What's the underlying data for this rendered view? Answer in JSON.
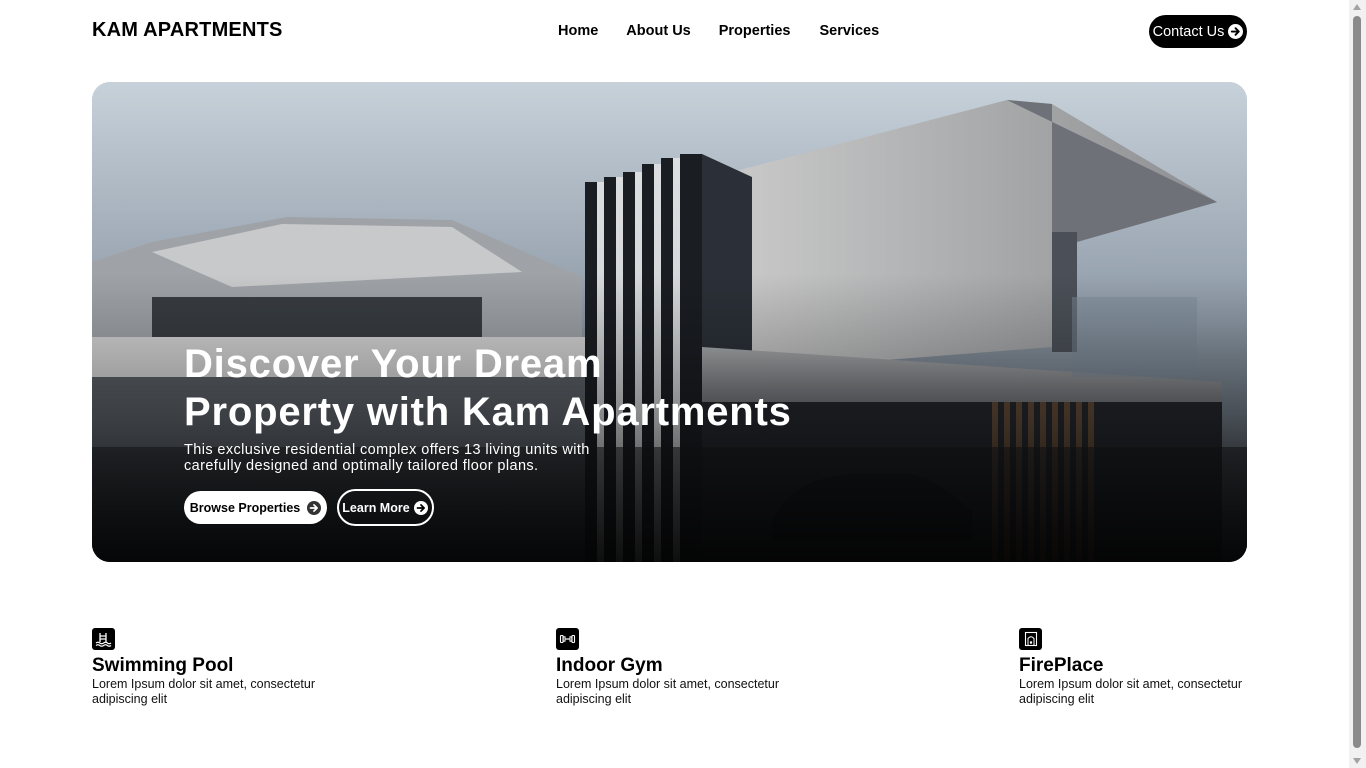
{
  "header": {
    "brand": "KAM APARTMENTS",
    "nav": [
      "Home",
      "About Us",
      "Properties",
      "Services"
    ],
    "contact_label": "Contact Us"
  },
  "hero": {
    "title_line1": "Discover Your Dream",
    "title_line2": "Property with Kam Apartments",
    "subtitle": "This exclusive residential complex offers 13 living units with carefully designed and optimally tailored floor plans.",
    "browse_label": "Browse Properties",
    "learn_label": "Learn More"
  },
  "features": [
    {
      "title": "Swimming Pool",
      "text": "Lorem Ipsum dolor sit amet, consectetur adipiscing elit",
      "icon": "swimming-pool-icon"
    },
    {
      "title": "Indoor Gym",
      "text": "Lorem Ipsum dolor sit amet, consectetur adipiscing elit",
      "icon": "dumbbell-icon"
    },
    {
      "title": "FirePlace",
      "text": "Lorem Ipsum dolor sit amet, consectetur adipiscing elit",
      "icon": "fireplace-icon"
    }
  ],
  "colors": {
    "primary": "#000000",
    "background": "#ffffff",
    "hero_text": "#ffffff"
  }
}
